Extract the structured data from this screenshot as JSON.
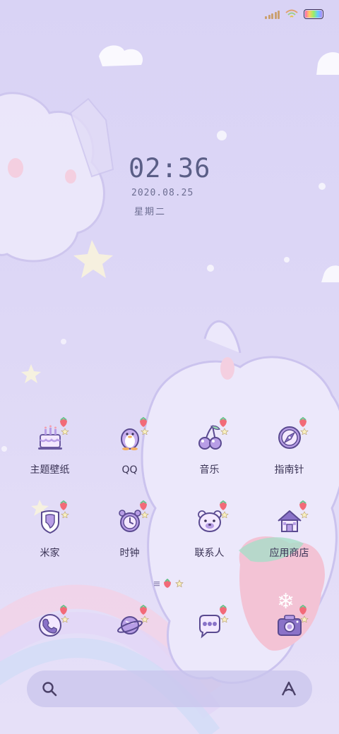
{
  "lockscreen": {
    "time": "02:36",
    "date": "2020.08.25",
    "weekday": "星期二"
  },
  "apps": [
    {
      "label": "主题壁纸",
      "icon": "cake-icon"
    },
    {
      "label": "QQ",
      "icon": "penguin-icon"
    },
    {
      "label": "音乐",
      "icon": "cherry-icon"
    },
    {
      "label": "指南针",
      "icon": "compass-icon"
    },
    {
      "label": "米家",
      "icon": "mi-home-shield-icon"
    },
    {
      "label": "时钟",
      "icon": "alarm-clock-icon"
    },
    {
      "label": "联系人",
      "icon": "bear-face-icon"
    },
    {
      "label": "应用商店",
      "icon": "house-icon"
    }
  ],
  "dock": [
    {
      "icon": "phone-icon"
    },
    {
      "icon": "planet-icon"
    },
    {
      "icon": "message-bubble-icon"
    },
    {
      "icon": "camera-icon"
    }
  ],
  "colors": {
    "accent": "#8a72c8",
    "icon_fill": "#b89ee6",
    "label": "#3a3355",
    "clock": "#5a5e86"
  }
}
